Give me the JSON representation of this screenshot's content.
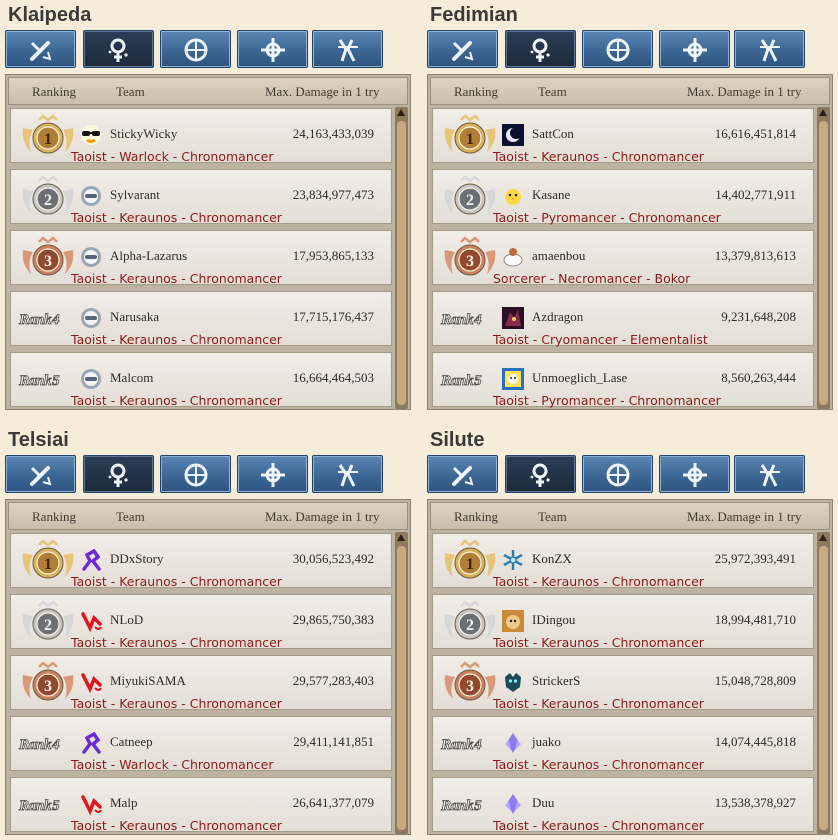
{
  "header": {
    "ranking": "Ranking",
    "team": "Team",
    "damage": "Max. Damage in 1 try"
  },
  "tab_icons": [
    "swordsman-icon",
    "wizard-icon",
    "archer-icon",
    "cleric-icon",
    "scout-icon"
  ],
  "active_tab_index": 1,
  "rank_prefix": "Rank",
  "servers": [
    {
      "name": "Klaipeda",
      "entries": [
        {
          "rank": "1",
          "player": "StickyWicky",
          "damage": "24,163,433,039",
          "classes": "Taoist - Warlock - Chronomancer",
          "avatar": "sunglasses-icon"
        },
        {
          "rank": "2",
          "player": "Sylvarant",
          "damage": "23,834,977,473",
          "classes": "Taoist - Keraunos - Chronomancer",
          "avatar": "helmet-icon"
        },
        {
          "rank": "3",
          "player": "Alpha-Lazarus",
          "damage": "17,953,865,133",
          "classes": "Taoist - Keraunos - Chronomancer",
          "avatar": "helmet-icon"
        },
        {
          "rank": "4",
          "player": "Narusaka",
          "damage": "17,715,176,437",
          "classes": "Taoist - Keraunos - Chronomancer",
          "avatar": "helmet-icon"
        },
        {
          "rank": "5",
          "player": "Malcom",
          "damage": "16,664,464,503",
          "classes": "Taoist - Keraunos - Chronomancer",
          "avatar": "helmet-icon"
        }
      ]
    },
    {
      "name": "Fedimian",
      "entries": [
        {
          "rank": "1",
          "player": "SattCon",
          "damage": "16,616,451,814",
          "classes": "Taoist - Keraunos - Chronomancer",
          "avatar": "moon-icon"
        },
        {
          "rank": "2",
          "player": "Kasane",
          "damage": "14,402,771,911",
          "classes": "Taoist - Pyromancer - Chronomancer",
          "avatar": "chick-icon"
        },
        {
          "rank": "3",
          "player": "amaenbou",
          "damage": "13,379,813,613",
          "classes": "Sorcerer - Necromancer - Bokor",
          "avatar": "cup-icon"
        },
        {
          "rank": "4",
          "player": "Azdragon",
          "damage": "9,231,648,208",
          "classes": "Taoist - Cryomancer - Elementalist",
          "avatar": "dragon-icon"
        },
        {
          "rank": "5",
          "player": "Unmoeglich_Lase",
          "damage": "8,560,263,444",
          "classes": "Taoist - Pyromancer - Chronomancer",
          "avatar": "portrait-icon"
        }
      ]
    },
    {
      "name": "Telsiai",
      "entries": [
        {
          "rank": "1",
          "player": "DDxStory",
          "damage": "30,056,523,492",
          "classes": "Taoist - Keraunos - Chronomancer",
          "avatar": "purple-figure-icon"
        },
        {
          "rank": "2",
          "player": "NLoD",
          "damage": "29,865,750,383",
          "classes": "Taoist - Keraunos - Chronomancer",
          "avatar": "red-swirl-icon"
        },
        {
          "rank": "3",
          "player": "MiyukiSAMA",
          "damage": "29,577,283,403",
          "classes": "Taoist - Keraunos - Chronomancer",
          "avatar": "red-swirl-icon"
        },
        {
          "rank": "4",
          "player": "Catneep",
          "damage": "29,411,141,851",
          "classes": "Taoist - Warlock - Chronomancer",
          "avatar": "purple-figure-icon"
        },
        {
          "rank": "5",
          "player": "Malp",
          "damage": "26,641,377,079",
          "classes": "Taoist - Keraunos - Chronomancer",
          "avatar": "red-swirl-icon"
        }
      ]
    },
    {
      "name": "Silute",
      "entries": [
        {
          "rank": "1",
          "player": "KonZX",
          "damage": "25,972,393,491",
          "classes": "Taoist - Keraunos - Chronomancer",
          "avatar": "snowflake-icon"
        },
        {
          "rank": "2",
          "player": "IDingou",
          "damage": "18,994,481,710",
          "classes": "Taoist - Keraunos - Chronomancer",
          "avatar": "dog-icon"
        },
        {
          "rank": "3",
          "player": "StrickerS",
          "damage": "15,048,728,809",
          "classes": "Taoist - Keraunos - Chronomancer",
          "avatar": "beast-icon"
        },
        {
          "rank": "4",
          "player": "juako",
          "damage": "14,074,445,818",
          "classes": "Taoist - Keraunos - Chronomancer",
          "avatar": "crystal-icon"
        },
        {
          "rank": "5",
          "player": "Duu",
          "damage": "13,538,378,927",
          "classes": "Taoist - Keraunos - Chronomancer",
          "avatar": "crystal-icon"
        }
      ]
    }
  ]
}
